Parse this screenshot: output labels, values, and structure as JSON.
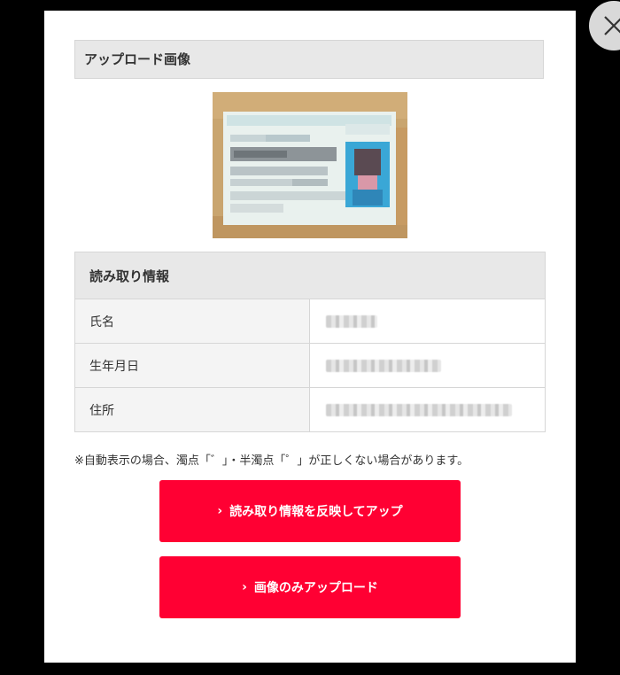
{
  "modal": {
    "close_icon": "close-x-icon",
    "upload_section_title": "アップロード画像",
    "info_section_title": "読み取り情報",
    "rows": [
      {
        "label": "氏名"
      },
      {
        "label": "生年月日"
      },
      {
        "label": "住所"
      }
    ],
    "note": "※自動表示の場合、濁点「゛」・半濁点「゜」が正しくない場合があります。",
    "buttons": {
      "apply_label": "読み取り情報を反映してアップ",
      "image_only_label": "画像のみアップロード",
      "chevron": "›"
    },
    "colors": {
      "accent": "#ff0033",
      "header_bg": "#e8e8e8",
      "close_bg": "#d9d9d9"
    }
  }
}
